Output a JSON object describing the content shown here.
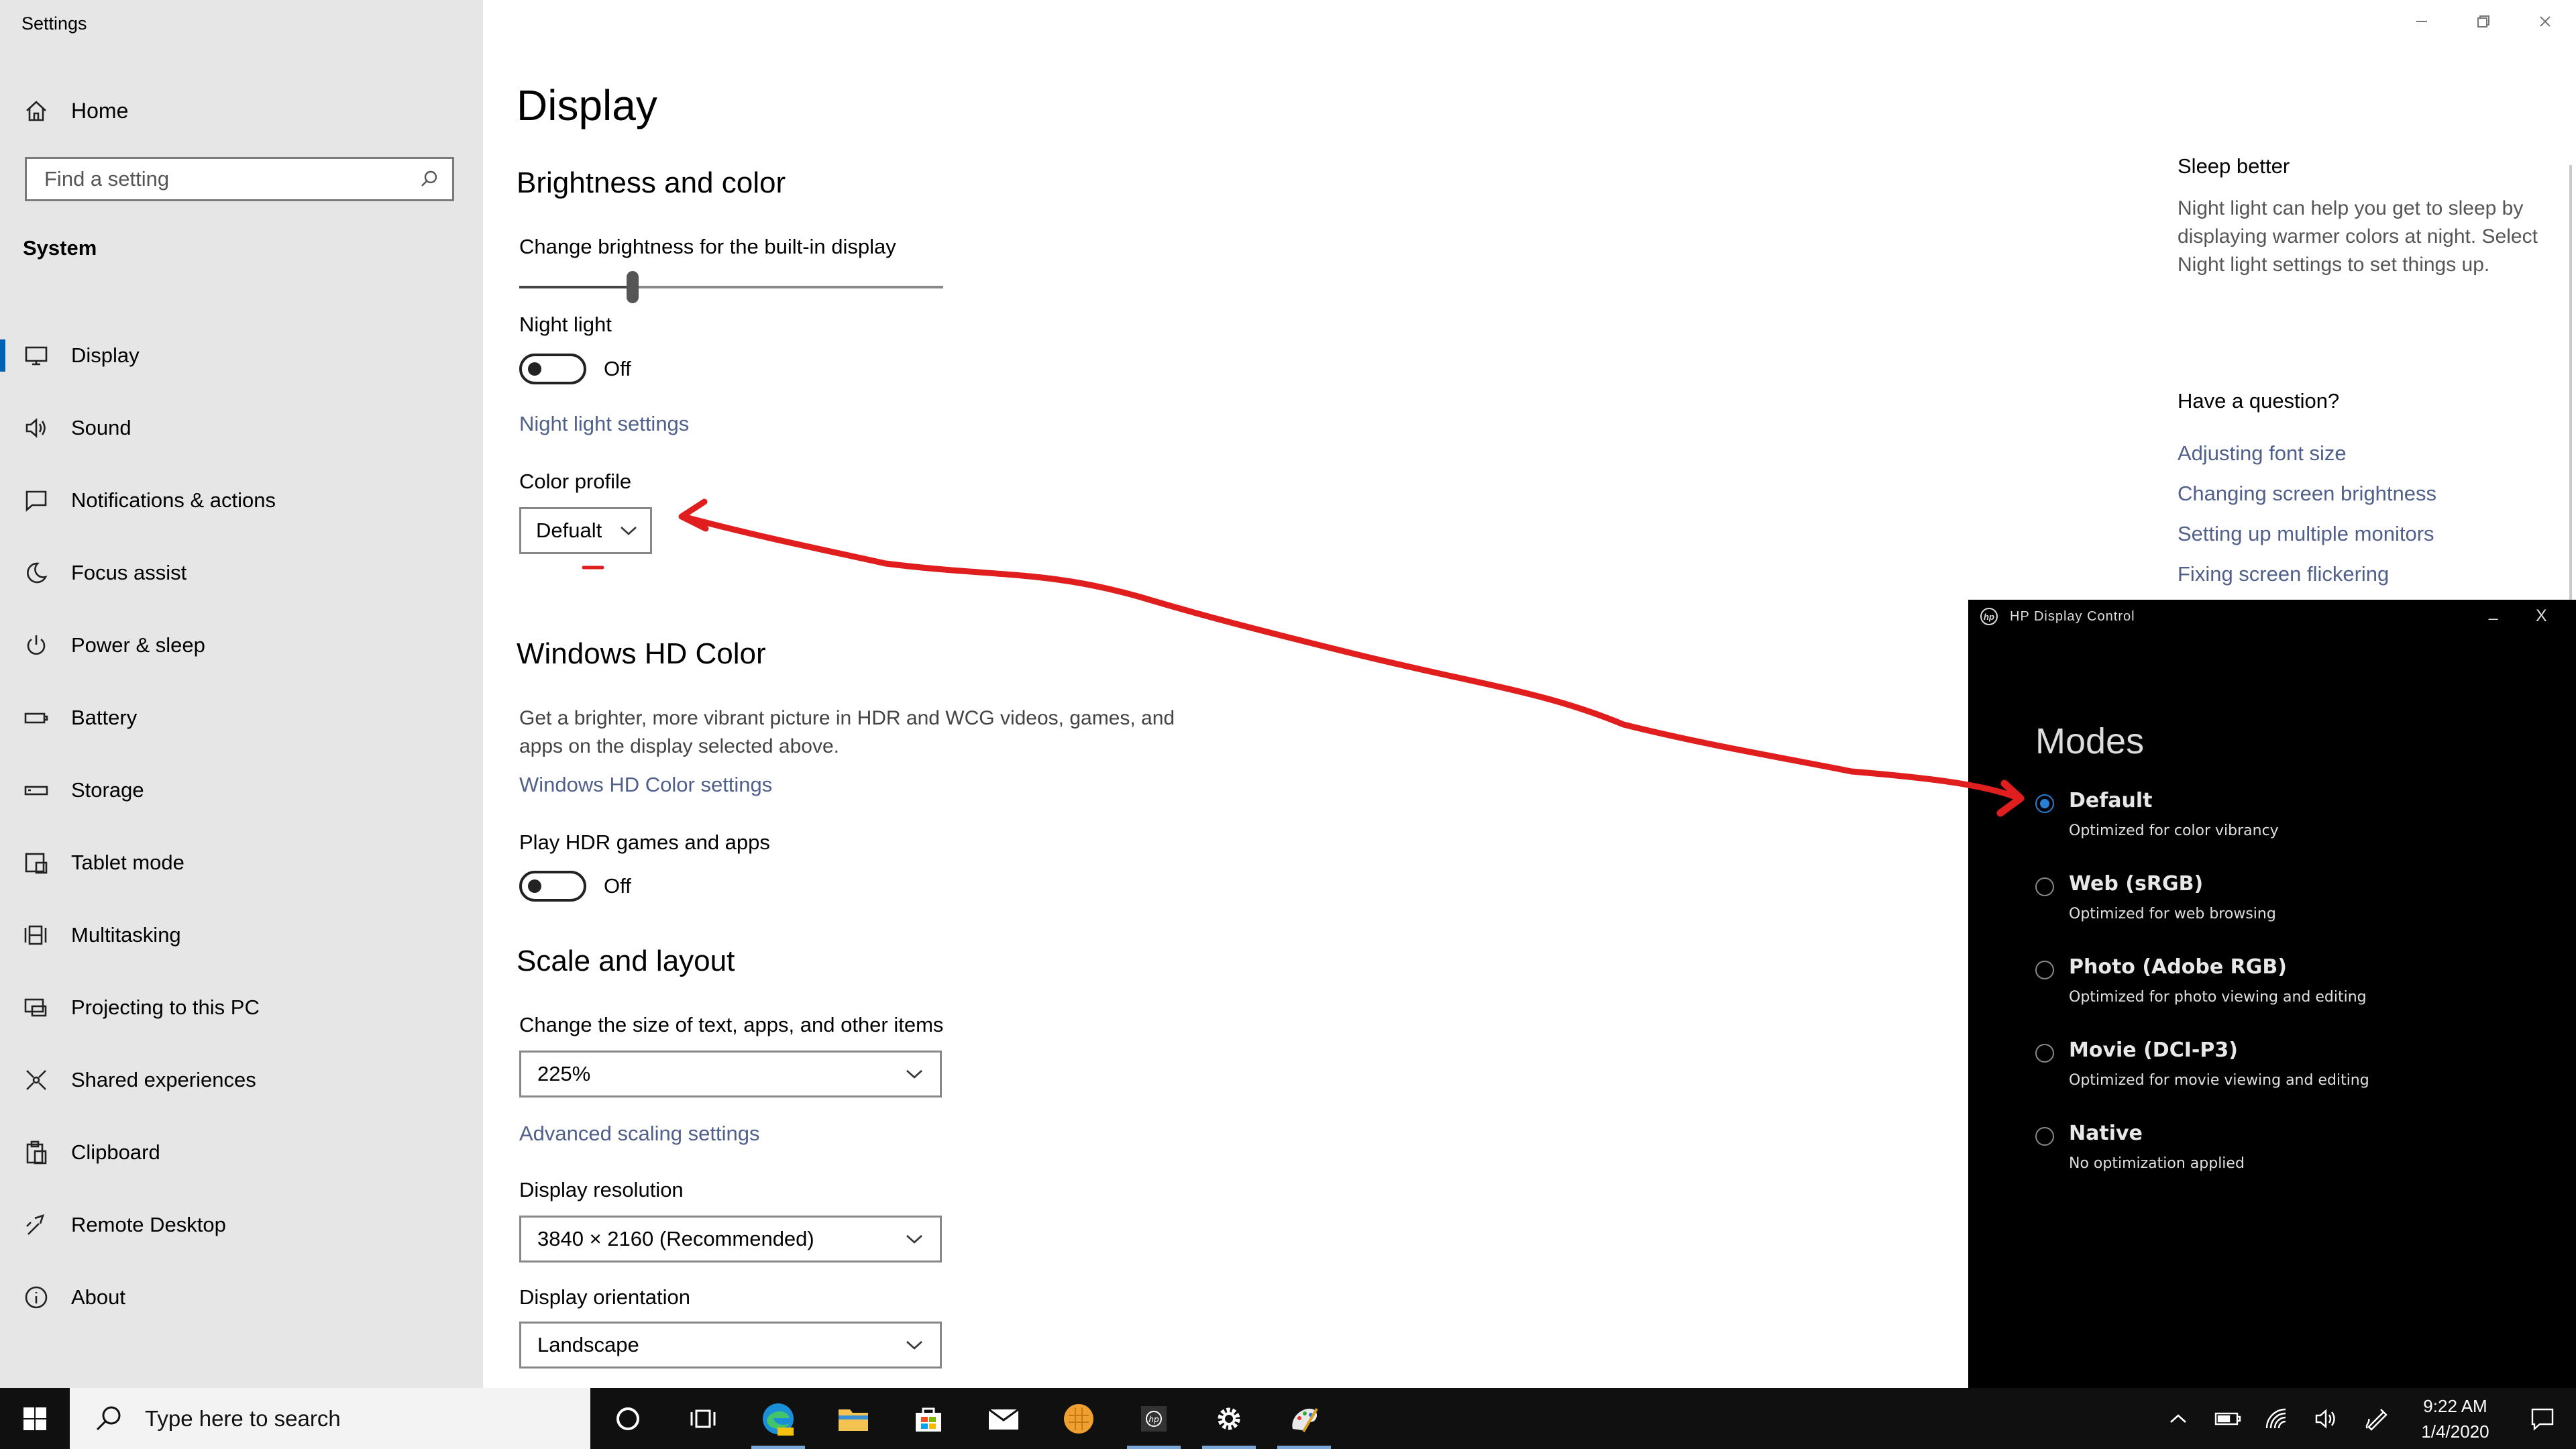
{
  "window": {
    "title": "Settings"
  },
  "sidebar": {
    "home_label": "Home",
    "search_placeholder": "Find a setting",
    "section": "System",
    "items": [
      {
        "label": "Display",
        "icon": "monitor-icon",
        "active": true
      },
      {
        "label": "Sound",
        "icon": "speaker-icon"
      },
      {
        "label": "Notifications & actions",
        "icon": "notification-icon"
      },
      {
        "label": "Focus assist",
        "icon": "moon-icon"
      },
      {
        "label": "Power & sleep",
        "icon": "power-icon"
      },
      {
        "label": "Battery",
        "icon": "battery-icon"
      },
      {
        "label": "Storage",
        "icon": "storage-icon"
      },
      {
        "label": "Tablet mode",
        "icon": "tablet-icon"
      },
      {
        "label": "Multitasking",
        "icon": "multitasking-icon"
      },
      {
        "label": "Projecting to this PC",
        "icon": "projecting-icon"
      },
      {
        "label": "Shared experiences",
        "icon": "shared-icon"
      },
      {
        "label": "Clipboard",
        "icon": "clipboard-icon"
      },
      {
        "label": "Remote Desktop",
        "icon": "remote-desktop-icon"
      },
      {
        "label": "About",
        "icon": "info-icon"
      }
    ]
  },
  "main": {
    "title": "Display",
    "brightness": {
      "heading": "Brightness and color",
      "slider_label": "Change brightness for the built-in display",
      "slider_value": 0.26,
      "night_light_label": "Night light",
      "night_light_state": "Off",
      "night_light_link": "Night light settings",
      "color_profile_label": "Color profile",
      "color_profile_value": "Defualt"
    },
    "hdr": {
      "heading": "Windows HD Color",
      "description": "Get a brighter, more vibrant picture in HDR and WCG videos, games, and apps on the display selected above.",
      "link": "Windows HD Color settings",
      "play_label": "Play HDR games and apps",
      "play_state": "Off"
    },
    "scale": {
      "heading": "Scale and layout",
      "size_label": "Change the size of text, apps, and other items",
      "size_value": "225%",
      "advanced_link": "Advanced scaling settings",
      "resolution_label": "Display resolution",
      "resolution_value": "3840 × 2160 (Recommended)",
      "orientation_label": "Display orientation",
      "orientation_value": "Landscape"
    }
  },
  "help": {
    "sleep_heading": "Sleep better",
    "sleep_text": "Night light can help you get to sleep by displaying warmer colors at night. Select Night light settings to set things up.",
    "question_heading": "Have a question?",
    "links": [
      "Adjusting font size",
      "Changing screen brightness",
      "Setting up multiple monitors",
      "Fixing screen flickering"
    ]
  },
  "hp": {
    "title": "HP Display Control",
    "minimize": "_",
    "close": "X",
    "modes_title": "Modes",
    "modes": [
      {
        "name": "Default",
        "sub": "Optimized for color vibrancy",
        "selected": true
      },
      {
        "name": "Web (sRGB)",
        "sub": "Optimized for web browsing"
      },
      {
        "name": "Photo (Adobe RGB)",
        "sub": "Optimized for photo viewing and editing"
      },
      {
        "name": "Movie (DCI-P3)",
        "sub": "Optimized for movie viewing and editing"
      },
      {
        "name": "Native",
        "sub": "No optimization applied"
      }
    ]
  },
  "taskbar": {
    "search_placeholder": "Type here to search",
    "time": "9:22 AM",
    "date": "1/4/2020"
  },
  "colors": {
    "accent": "#0063b1",
    "link": "#50608a",
    "annotation": "#e01e1e",
    "hp_radio": "#2a7fd4"
  }
}
